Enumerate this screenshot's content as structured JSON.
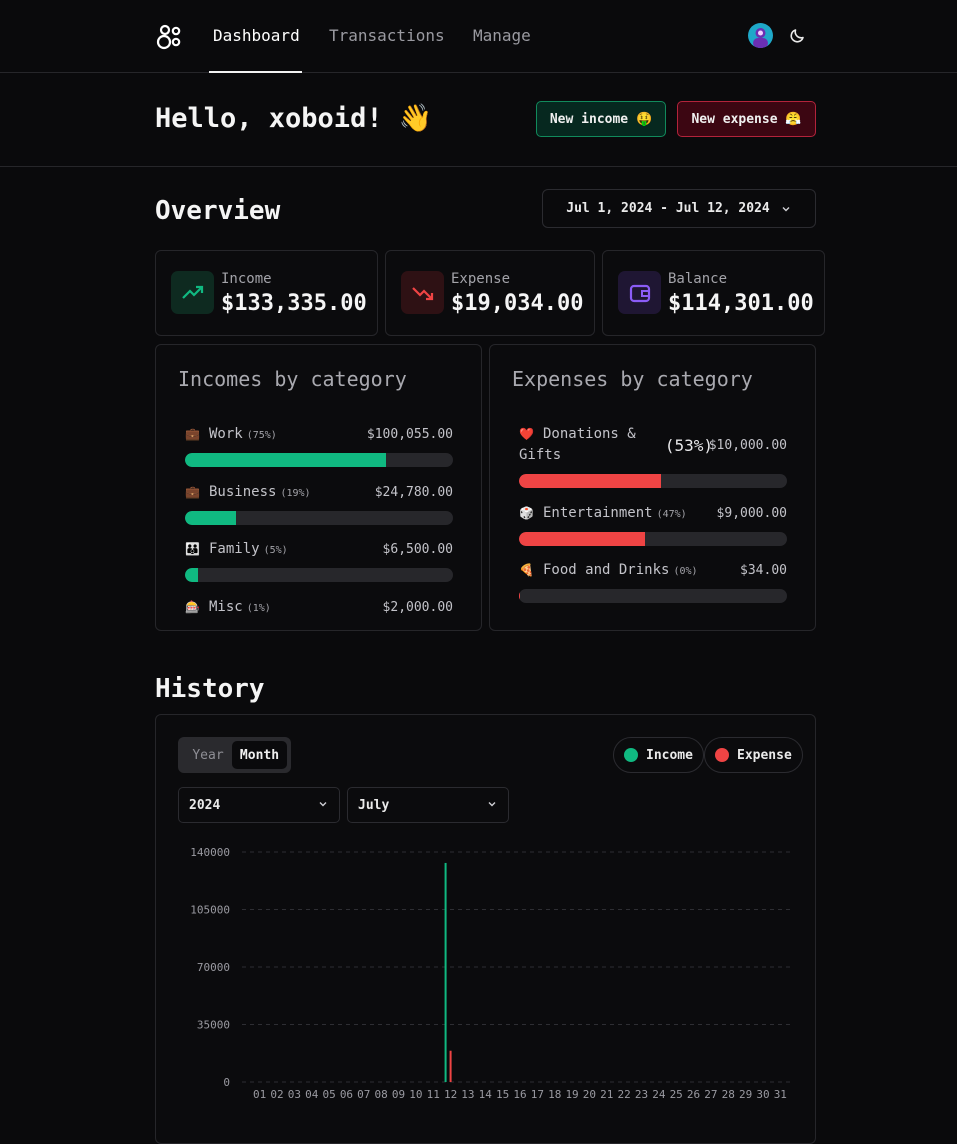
{
  "nav": {
    "links": [
      "Dashboard",
      "Transactions",
      "Manage"
    ],
    "active_index": 0
  },
  "hero": {
    "greeting": "Hello, xoboid! 👋",
    "new_income_label": "New income 🤑",
    "new_expense_label": "New expense 😤"
  },
  "overview": {
    "title": "Overview",
    "date_range": "Jul 1, 2024 - Jul 12, 2024",
    "stats": [
      {
        "label": "Income",
        "value": "$133,335.00",
        "icon": "trending-up-icon",
        "color": "#10b981"
      },
      {
        "label": "Expense",
        "value": "$19,034.00",
        "icon": "trending-down-icon",
        "color": "#ef4444"
      },
      {
        "label": "Balance",
        "value": "$114,301.00",
        "icon": "wallet-icon",
        "color": "#8b5cf6"
      }
    ]
  },
  "incomes": {
    "title": "Incomes by category",
    "color": "#10b981",
    "items": [
      {
        "emoji": "💼",
        "name": "Work",
        "pct": "(75%)",
        "amount": "$100,055.00",
        "fraction": 0.75
      },
      {
        "emoji": "💼",
        "name": "Business",
        "pct": "(19%)",
        "amount": "$24,780.00",
        "fraction": 0.19
      },
      {
        "emoji": "👪",
        "name": "Family",
        "pct": "(5%)",
        "amount": "$6,500.00",
        "fraction": 0.05
      },
      {
        "emoji": "🎰",
        "name": "Misc",
        "pct": "(1%)",
        "amount": "$2,000.00",
        "fraction": 0.01
      }
    ]
  },
  "expenses": {
    "title": "Expenses by category",
    "color": "#ef4444",
    "items": [
      {
        "emoji": "❤️",
        "name": "Donations & Gifts",
        "pct": "(53%)",
        "amount": "$10,000.00",
        "fraction": 0.53
      },
      {
        "emoji": "🎲",
        "name": "Entertainment",
        "pct": "(47%)",
        "amount": "$9,000.00",
        "fraction": 0.47
      },
      {
        "emoji": "🍕",
        "name": "Food and Drinks",
        "pct": "(0%)",
        "amount": "$34.00",
        "fraction": 0.002
      }
    ]
  },
  "history": {
    "title": "History",
    "toggle": [
      "Year",
      "Month"
    ],
    "toggle_active": "Month",
    "legend": [
      {
        "label": "Income",
        "color": "#10b981"
      },
      {
        "label": "Expense",
        "color": "#ef4444"
      }
    ],
    "year_select": "2024",
    "month_select": "July"
  },
  "chart_data": {
    "type": "bar",
    "categories": [
      "01",
      "02",
      "03",
      "04",
      "05",
      "06",
      "07",
      "08",
      "09",
      "10",
      "11",
      "12",
      "13",
      "14",
      "15",
      "16",
      "17",
      "18",
      "19",
      "20",
      "21",
      "22",
      "23",
      "24",
      "25",
      "26",
      "27",
      "28",
      "29",
      "30",
      "31"
    ],
    "series": [
      {
        "name": "Income",
        "color": "#10b981",
        "values": [
          0,
          0,
          0,
          0,
          0,
          0,
          0,
          0,
          0,
          0,
          0,
          133335,
          0,
          0,
          0,
          0,
          0,
          0,
          0,
          0,
          0,
          0,
          0,
          0,
          0,
          0,
          0,
          0,
          0,
          0,
          0
        ]
      },
      {
        "name": "Expense",
        "color": "#ef4444",
        "values": [
          0,
          0,
          0,
          0,
          0,
          0,
          0,
          0,
          0,
          0,
          0,
          19034,
          0,
          0,
          0,
          0,
          0,
          0,
          0,
          0,
          0,
          0,
          0,
          0,
          0,
          0,
          0,
          0,
          0,
          0,
          0
        ]
      }
    ],
    "y_ticks": [
      "0",
      "35000",
      "70000",
      "105000",
      "140000"
    ],
    "ylim": [
      0,
      140000
    ],
    "grid": true
  }
}
